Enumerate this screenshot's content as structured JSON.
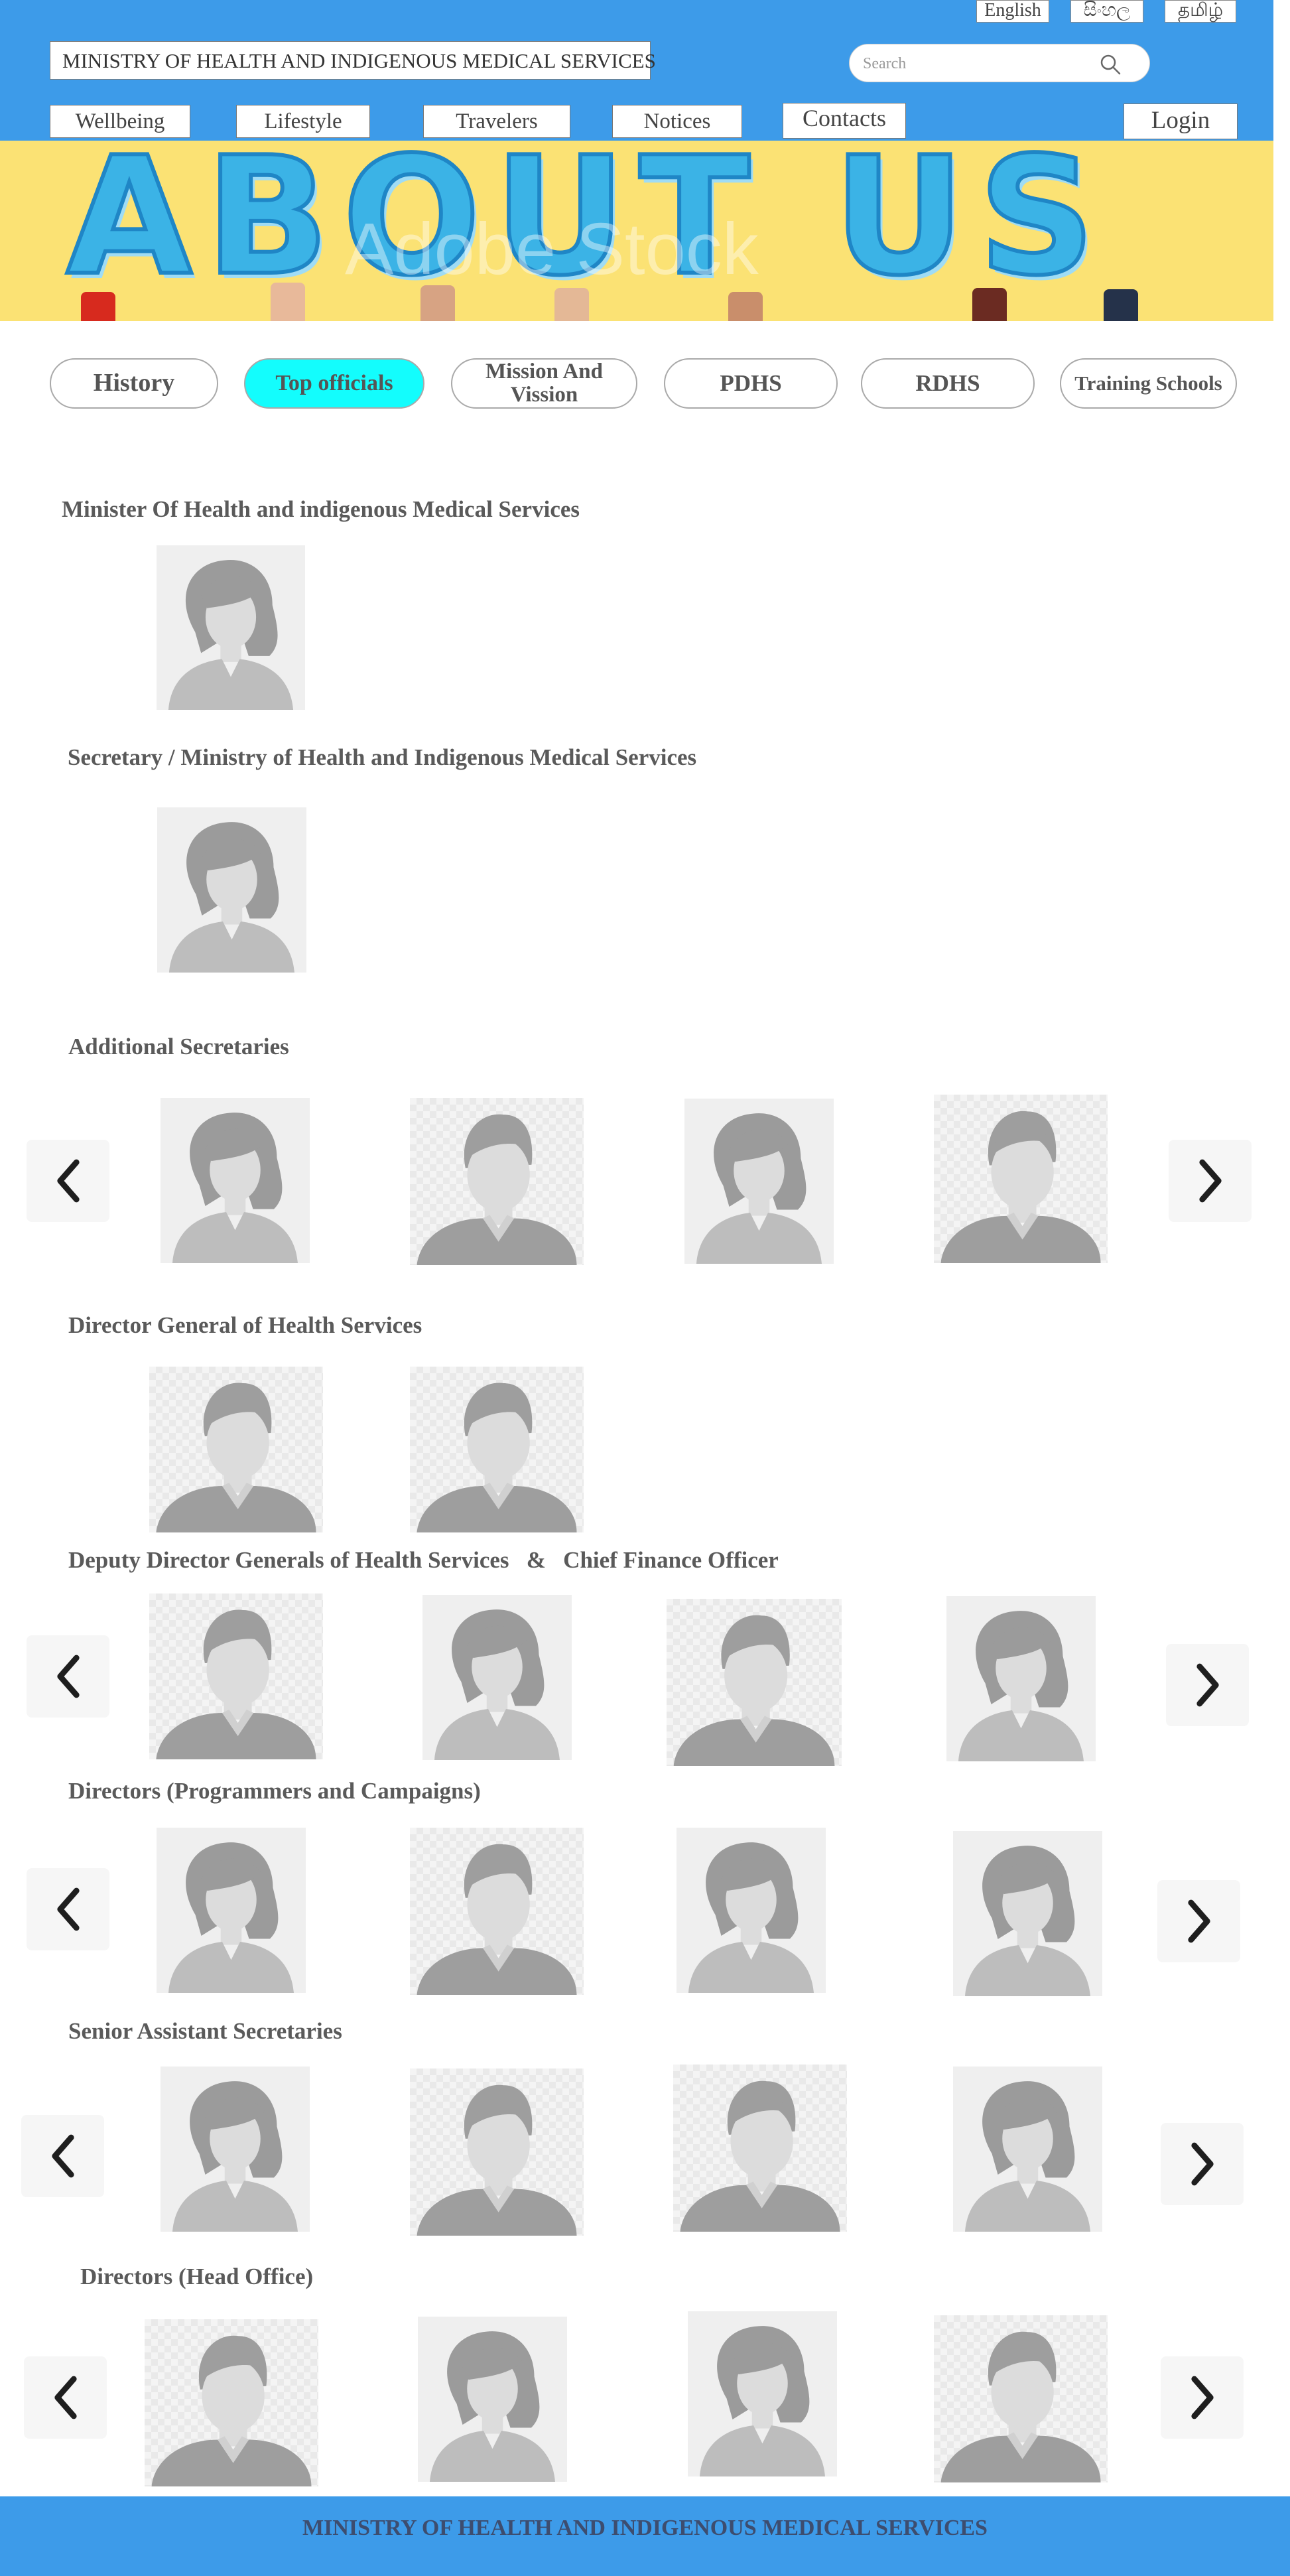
{
  "header": {
    "languages": [
      "English",
      "සිංහල",
      "தமிழ்"
    ],
    "site_title": "MINISTRY OF HEALTH AND INDIGENOUS MEDICAL SERVICES",
    "search_placeholder": "Search",
    "nav": [
      "Wellbeing",
      "Lifestyle",
      "Travelers",
      "Notices",
      "Contacts"
    ],
    "login_label": "Login"
  },
  "banner": {
    "title": "ABOUT US",
    "watermark": "Adobe Stock"
  },
  "tabs": [
    {
      "label": "History",
      "active": false
    },
    {
      "label": "Top officials",
      "active": true
    },
    {
      "label": "Mission And Vission",
      "active": false
    },
    {
      "label": "PDHS",
      "active": false
    },
    {
      "label": "RDHS",
      "active": false
    },
    {
      "label": "Training Schools",
      "active": false
    }
  ],
  "sections": [
    {
      "title": "Minister Of Health and indigenous Medical Services",
      "photos": [
        "female"
      ]
    },
    {
      "title": "Secretary / Ministry of Health and Indigenous Medical Services",
      "photos": [
        "female"
      ]
    },
    {
      "title": "Additional Secretaries",
      "photos": [
        "female",
        "male",
        "female",
        "male"
      ]
    },
    {
      "title": "Director General of Health Services",
      "photos": [
        "male",
        "male"
      ]
    },
    {
      "title": "Deputy Director Generals of Health Services   &   Chief Finance Officer",
      "photos": [
        "male",
        "female",
        "male",
        "female"
      ]
    },
    {
      "title": "Directors (Programmers and Campaigns)",
      "photos": [
        "female",
        "male",
        "female",
        "female"
      ]
    },
    {
      "title": "Senior Assistant Secretaries",
      "photos": [
        "female",
        "male",
        "male",
        "female"
      ]
    },
    {
      "title": "Directors (Head Office)",
      "photos": [
        "male",
        "female",
        "female",
        "male"
      ]
    }
  ],
  "footer": {
    "text": "MINISTRY OF HEALTH AND INDIGENOUS MEDICAL SERVICES"
  },
  "colors": {
    "header_bg": "#3d9be9",
    "banner_bg": "#fbe274",
    "active_tab": "#13fdfd",
    "footer_text": "#3d4d6f"
  }
}
